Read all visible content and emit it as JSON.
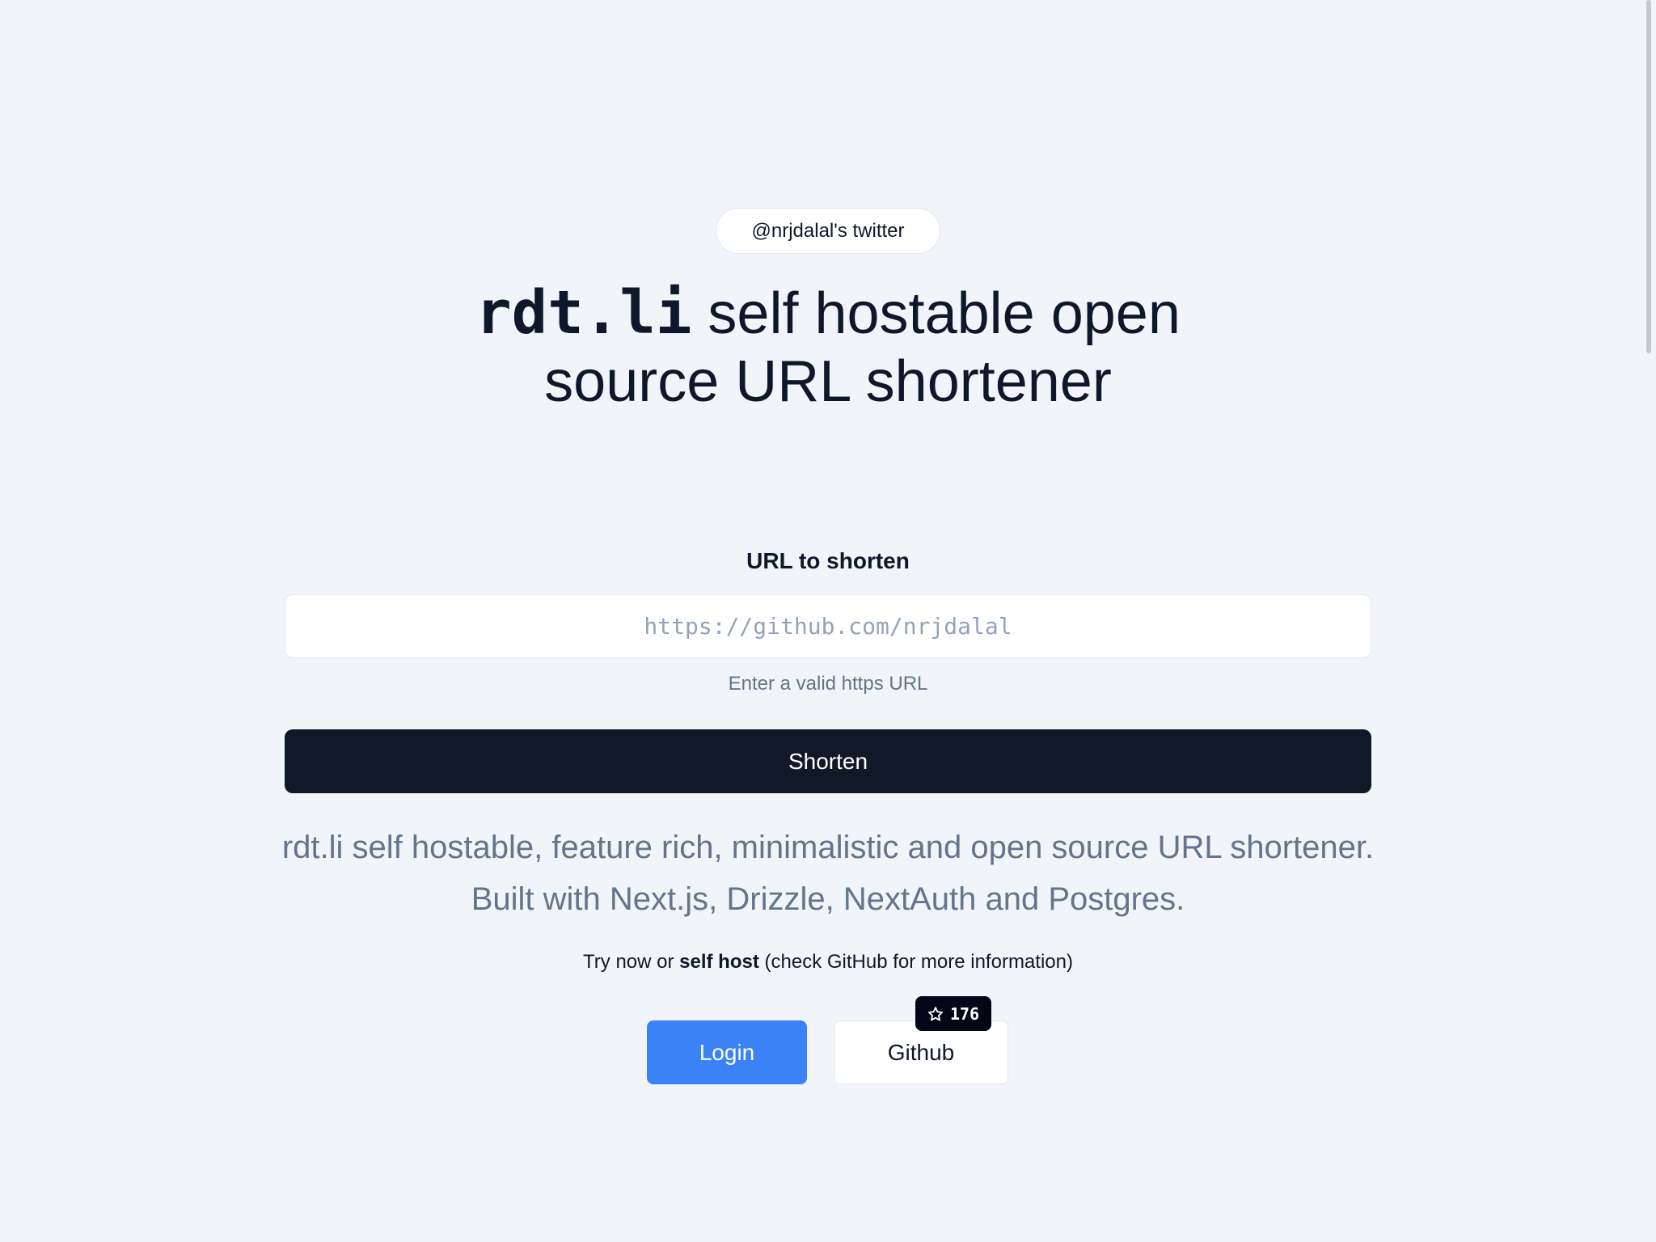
{
  "header": {
    "twitter_link": "@nrjdalal's twitter"
  },
  "hero": {
    "brand": "rdt.li",
    "headline_rest_line1": " self hostable open",
    "headline_line2": "source URL shortener"
  },
  "form": {
    "label": "URL to shorten",
    "placeholder": "https://github.com/nrjdalal",
    "value": "",
    "helper": "Enter a valid https URL",
    "submit_label": "Shorten"
  },
  "description": {
    "line1": "rdt.li self hostable, feature rich, minimalistic and open source URL shortener.",
    "line2": "Built with Next.js, Drizzle, NextAuth and Postgres."
  },
  "cta": {
    "try_prefix": "Try now or ",
    "try_bold": "self host",
    "try_suffix": " (check GitHub for more information)",
    "login_label": "Login",
    "github_label": "Github",
    "star_icon": "star-icon",
    "star_count": "176"
  },
  "colors": {
    "background": "#f1f5f9",
    "primary_dark": "#111827",
    "login_blue": "#3b82f6",
    "muted_text": "#64748b"
  }
}
